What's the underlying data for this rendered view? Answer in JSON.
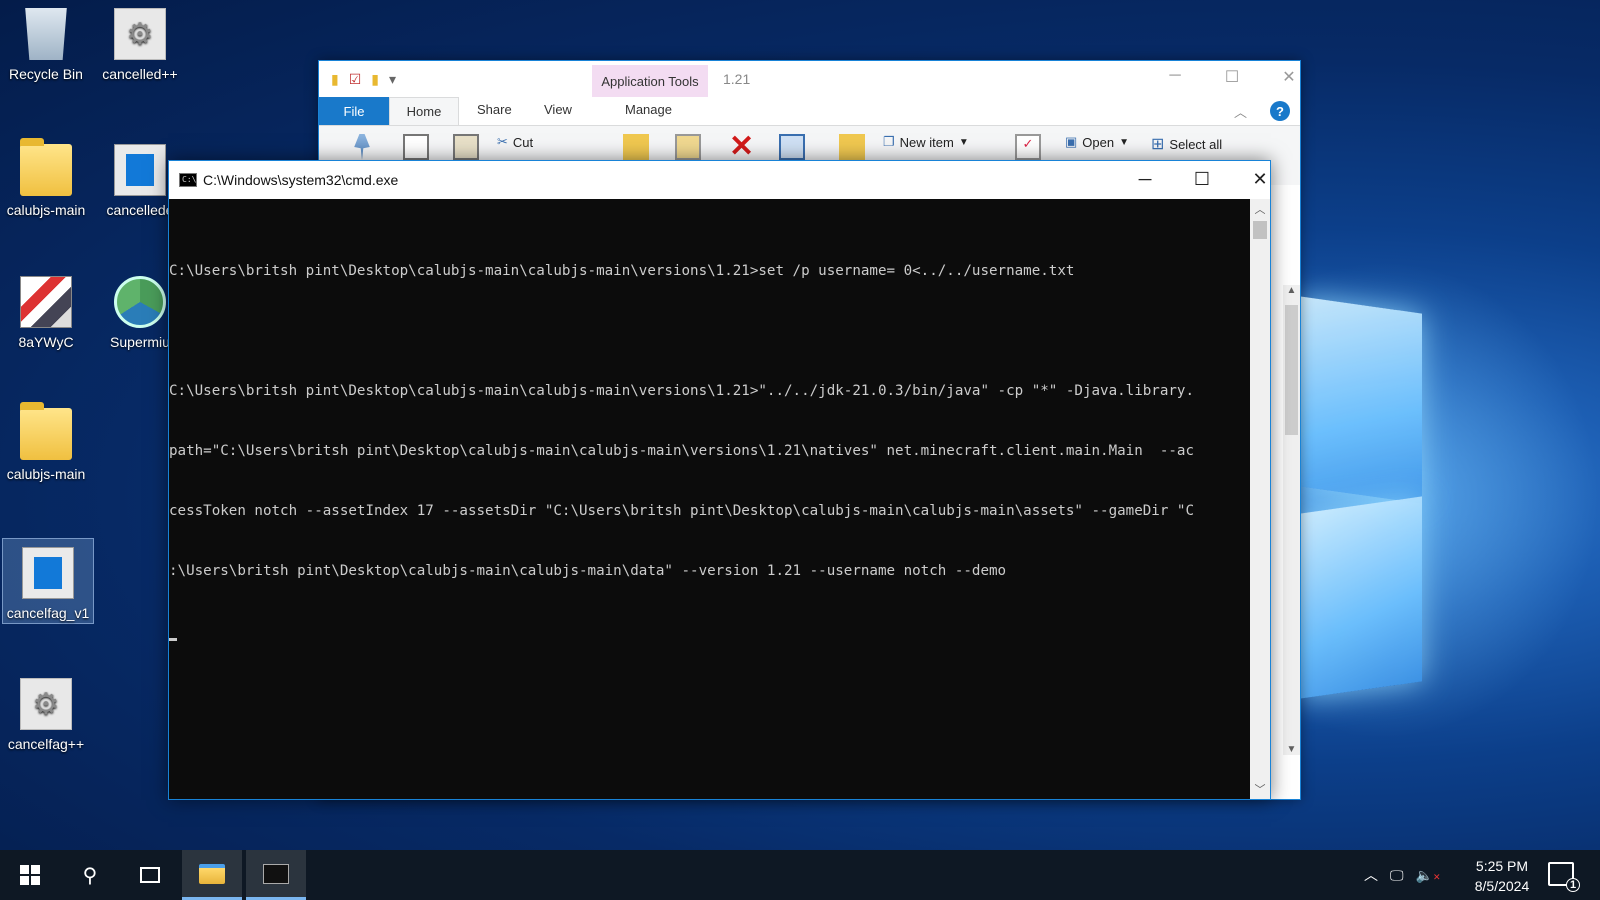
{
  "desktop": {
    "icons": [
      {
        "label": "Recycle Bin",
        "icon": "recycle-bin-icon"
      },
      {
        "label": "cancelled++",
        "icon": "gears-app-icon"
      },
      {
        "label": "calubjs-main",
        "icon": "folder-icon"
      },
      {
        "label": "cancellede",
        "icon": "window-app-icon"
      },
      {
        "label": "8aYWyC",
        "icon": "image-file-icon"
      },
      {
        "label": "Supermiu",
        "icon": "shortcut-app-icon"
      },
      {
        "label": "calubjs-main",
        "icon": "zip-folder-icon"
      },
      {
        "label": "cancelfag_v1",
        "icon": "window-app-icon"
      },
      {
        "label": "cancelfag++",
        "icon": "gears-app-icon"
      }
    ]
  },
  "explorer": {
    "context_tab": "Application Tools",
    "title": "1.21",
    "tabs": {
      "file": "File",
      "home": "Home",
      "share": "Share",
      "view": "View",
      "manage": "Manage"
    },
    "ribbon": {
      "cut": "Cut",
      "new_item": "New item",
      "open": "Open",
      "select_all": "Select all"
    },
    "help": "?"
  },
  "cmd": {
    "title": "C:\\Windows\\system32\\cmd.exe",
    "lines": [
      "C:\\Users\\britsh pint\\Desktop\\calubjs-main\\calubjs-main\\versions\\1.21>set /p username= 0<../../username.txt",
      "",
      "C:\\Users\\britsh pint\\Desktop\\calubjs-main\\calubjs-main\\versions\\1.21>\"../../jdk-21.0.3/bin/java\" -cp \"*\" -Djava.library.",
      "path=\"C:\\Users\\britsh pint\\Desktop\\calubjs-main\\calubjs-main\\versions\\1.21\\natives\" net.minecraft.client.main.Main  --ac",
      "cessToken notch --assetIndex 17 --assetsDir \"C:\\Users\\britsh pint\\Desktop\\calubjs-main\\calubjs-main\\assets\" --gameDir \"C",
      ":\\Users\\britsh pint\\Desktop\\calubjs-main\\calubjs-main\\data\" --version 1.21 --username notch --demo"
    ]
  },
  "taskbar": {
    "time": "5:25 PM",
    "date": "8/5/2024",
    "notification_count": "1"
  }
}
